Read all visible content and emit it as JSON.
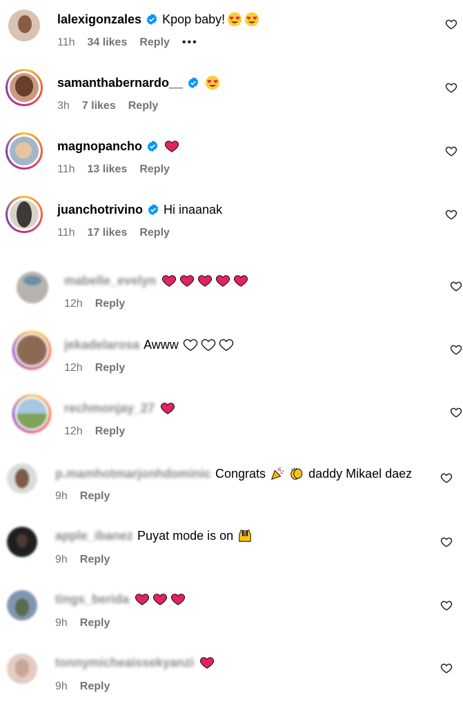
{
  "comments": [
    {
      "user": "lalexigonzales",
      "verified": true,
      "text": "Kpop baby!",
      "emojis": [
        "heart-eyes",
        "heart-eyes"
      ],
      "time": "11h",
      "likes": "34 likes",
      "reply": "Reply",
      "more": "•••"
    },
    {
      "user": "samanthabernardo__",
      "verified": true,
      "text": "",
      "emojis": [
        "heart-eyes"
      ],
      "time": "3h",
      "likes": "7 likes",
      "reply": "Reply"
    },
    {
      "user": "magnopancho",
      "verified": true,
      "text": "",
      "emojis": [
        "red-heart"
      ],
      "time": "11h",
      "likes": "13 likes",
      "reply": "Reply"
    },
    {
      "user": "juanchotrivino",
      "verified": true,
      "text": "Hi inaanak",
      "emojis": [],
      "time": "11h",
      "likes": "17 likes",
      "reply": "Reply"
    },
    {
      "user": "mabelle_evelyn",
      "blurred": true,
      "text": "",
      "emojis": [
        "red-heart",
        "red-heart",
        "red-heart",
        "red-heart",
        "red-heart"
      ],
      "time": "12h",
      "reply": "Reply"
    },
    {
      "user": "jekadelarosa",
      "blurred": true,
      "text": "Awww",
      "emojis": [
        "white-heart",
        "white-heart",
        "white-heart"
      ],
      "time": "12h",
      "reply": "Reply"
    },
    {
      "user": "rechmonjay_27",
      "blurred": true,
      "text": "",
      "emojis": [
        "red-heart"
      ],
      "time": "12h",
      "reply": "Reply"
    },
    {
      "user": "p.mamhotmarjonhdominic",
      "blurred": true,
      "text": "Congrats",
      "emojis": [
        "party-popper",
        "clapping-hands"
      ],
      "text2": "daddy Mikael daez",
      "time": "9h",
      "reply": "Reply"
    },
    {
      "user": "apple_ibanez",
      "blurred": true,
      "text": "Puyat mode is on",
      "emojis": [
        "raising-hands"
      ],
      "time": "9h",
      "reply": "Reply"
    },
    {
      "user": "tings_berida",
      "blurred": true,
      "text": "",
      "emojis": [
        "red-heart",
        "red-heart",
        "red-heart"
      ],
      "time": "9h",
      "reply": "Reply"
    },
    {
      "user": "tonnymicheaissekyanzi",
      "blurred": true,
      "text": "",
      "emojis": [
        "red-heart"
      ],
      "time": "9h",
      "reply": "Reply"
    }
  ],
  "colors": {
    "verified": "#0095f6",
    "meta": "#737373",
    "heart": "#e0245e"
  }
}
